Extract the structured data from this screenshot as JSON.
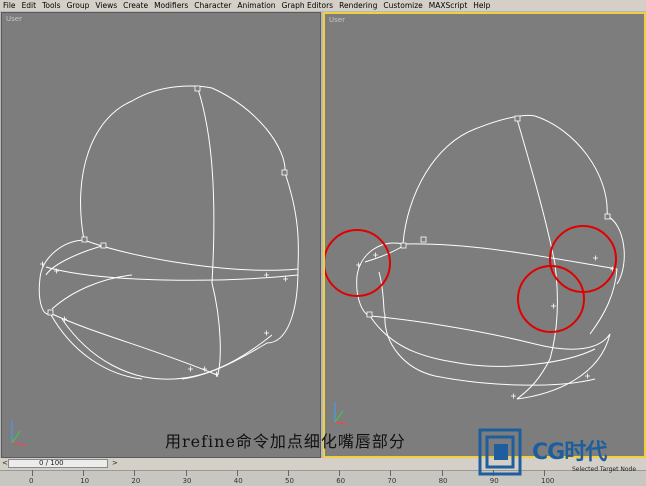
{
  "menu": [
    "File",
    "Edit",
    "Tools",
    "Group",
    "Views",
    "Create",
    "Modifiers",
    "Character",
    "Animation",
    "Graph Editors",
    "Rendering",
    "Customize",
    "MAXScript",
    "Help"
  ],
  "viewports": {
    "left_label": "User",
    "right_label": "User"
  },
  "caption": "用refine命令加点细化嘴唇部分",
  "timeline": {
    "frame_display": "0 / 100",
    "prev": "<",
    "next": ">"
  },
  "ruler_labels": [
    "0",
    "10",
    "20",
    "30",
    "40",
    "50",
    "60",
    "70",
    "80",
    "90",
    "100"
  ],
  "status_text": "Selected Target Node",
  "logo_text": "CG时代",
  "colors": {
    "viewport_bg": "#7d7d7d",
    "wire": "#ffffff",
    "highlight_circle": "#e00000",
    "active_border": "#f0d040",
    "logo_blue": "#1f5e9e"
  },
  "icons": [
    "axis-tripod-icon",
    "cg-logo-icon"
  ]
}
